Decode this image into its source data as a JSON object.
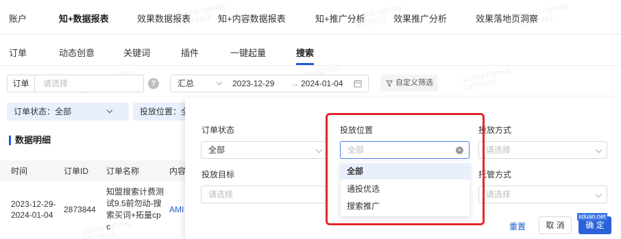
{
  "top_nav": {
    "tabs": [
      "账户",
      "知+数据报表",
      "效果数据报表",
      "知+内容数据报表",
      "知+推广分析",
      "效果推广分析",
      "效果落地页洞察"
    ],
    "active_index": 1
  },
  "sub_nav": {
    "tabs": [
      "订单",
      "动态创意",
      "关键词",
      "插件",
      "一键起量",
      "搜索"
    ],
    "active_index": 5
  },
  "filters": {
    "order_label": "订单",
    "order_placeholder": "请选择",
    "help_icon": "question-circle-icon",
    "agg_value": "汇总",
    "date_start": "2023-12-29",
    "date_sep": "→",
    "date_end": "2024-01-04",
    "calendar_icon": "calendar-icon",
    "custom_filter_label": "自定义筛选",
    "filter_icon": "filter-icon"
  },
  "chips": {
    "order_status": "订单状态：全部",
    "placement": "投放位置：全"
  },
  "section_title": "数据明细",
  "table": {
    "columns": [
      "时间",
      "订单ID",
      "订单名称",
      "内容I"
    ],
    "rows": [
      {
        "time": [
          "2023-12-29-",
          "2024-01-04"
        ],
        "order_id": "2873844",
        "order_name": [
          "知盟搜索计费测",
          "试9.5前勿动-搜",
          "索买词+拓量cp",
          "c"
        ],
        "content": "AMI"
      }
    ]
  },
  "panel": {
    "order_status_label": "订单状态",
    "order_status_value": "全部",
    "placement_label": "投放位置",
    "placement_placeholder": "全部",
    "placement_options": [
      "全部",
      "通投优选",
      "搜索推广"
    ],
    "placement_selected_index": 0,
    "delivery_method_label": "投放方式",
    "delivery_method_placeholder": "请选择",
    "delivery_target_label": "投放目标",
    "delivery_target_placeholder": "请选择",
    "hosting_method_label": "托管方式",
    "hosting_method_placeholder": "请选择",
    "reset_label": "重置",
    "cancel_label": "取 消",
    "ok_label": "确 定",
    "highlight_color": "#e0262a"
  },
  "watermark": {
    "name": "1lucha nghong",
    "number": "18778113",
    "site_tag": "xduan.net"
  }
}
